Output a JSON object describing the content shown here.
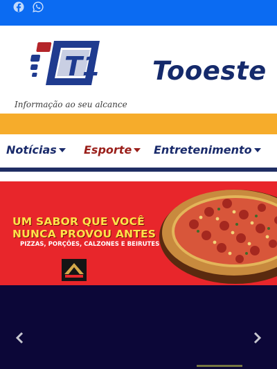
{
  "topbar": {
    "icons": [
      "facebook-icon",
      "whatsapp-icon"
    ],
    "color": "#0b6bf2"
  },
  "header": {
    "logo_text": "T1",
    "tagline": "Informação ao seu alcance",
    "brand": "Tooeste",
    "accent_band_color": "#f6ac2b"
  },
  "nav": {
    "items": [
      {
        "label": "Notícias"
      },
      {
        "label": "Esporte"
      },
      {
        "label": "Entretenimento"
      }
    ]
  },
  "slider": {
    "banner": {
      "headline_1": "UM SABOR QUE VOCÊ",
      "headline_2": "NUNCA PROVOU ANTES",
      "subline": "PIZZAS, PORÇÕES, CALZONES E BEIRUTES",
      "background": "#e8262b"
    },
    "controls": [
      "chevron-left-icon",
      "chevron-right-icon"
    ],
    "background": "#0c0738"
  }
}
